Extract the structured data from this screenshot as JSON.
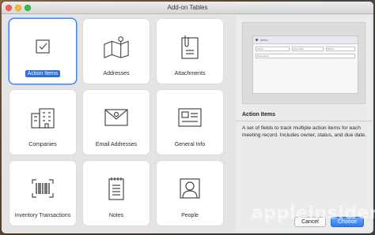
{
  "window": {
    "title": "Add-on Tables"
  },
  "tiles": [
    {
      "label": "Action Items",
      "icon": "checkbox-icon",
      "selected": true
    },
    {
      "label": "Addresses",
      "icon": "map-icon"
    },
    {
      "label": "Attachments",
      "icon": "paperclip-document-icon"
    },
    {
      "label": "Companies",
      "icon": "buildings-icon"
    },
    {
      "label": "Email Addresses",
      "icon": "envelope-icon"
    },
    {
      "label": "General Info",
      "icon": "id-card-icon"
    },
    {
      "label": "Inventory Transactions",
      "icon": "barcode-icon"
    },
    {
      "label": "Notes",
      "icon": "notepad-icon"
    },
    {
      "label": "People",
      "icon": "person-icon"
    }
  ],
  "preview": {
    "header": "Action",
    "fields": [
      "Owner",
      "Due Date",
      "Status"
    ],
    "description_label": "Description"
  },
  "detail": {
    "title": "Action Items",
    "text": "A set of fields to track multiple action items for each meeting record. Includes owner, status, and due date."
  },
  "buttons": {
    "cancel": "Cancel",
    "choose": "Choose"
  },
  "watermark": "appleinsider",
  "colors": {
    "accent": "#3b86f7",
    "selection": "#2f6fd6"
  }
}
